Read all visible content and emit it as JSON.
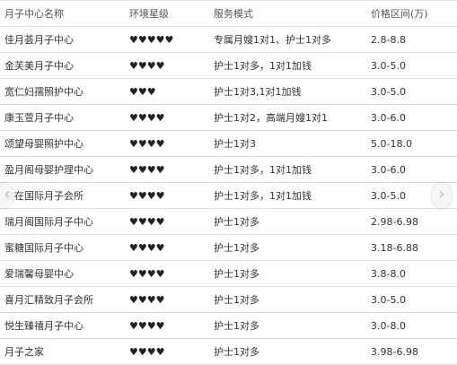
{
  "table": {
    "headers": [
      "月子中心名称",
      "环境星级",
      "服务模式",
      "价格区间(万)"
    ],
    "rows": [
      {
        "name": "佳月荟月子中心",
        "stars": "♥♥♥♥♥",
        "mode": "专属月嫂1对1、护士1对多",
        "price": "2.8-8.8"
      },
      {
        "name": "金芙美月子中心",
        "stars": "♥♥♥♥",
        "mode": "护士1对多，1对1加钱",
        "price": "3.0-5.0"
      },
      {
        "name": "宽仁妇孺照护中心",
        "stars": "♥♥♥",
        "mode": "护士1对3,1对1加钱",
        "price": "3.0-5.0"
      },
      {
        "name": "康玉萱月子中心",
        "stars": "♥♥♥♥",
        "mode": "护士1对2，高端月嫂1对1",
        "price": "3.0-6.0"
      },
      {
        "name": "颂望母婴照护中心",
        "stars": "♥♥♥♥",
        "mode": "护士1对3",
        "price": "5.0-18.0"
      },
      {
        "name": "盈月阁母婴护理中心",
        "stars": "♥♥♥♥",
        "mode": "护士1对多，1对1加钱",
        "price": "3.0-6.0"
      },
      {
        "name": "自在国际月子会所",
        "stars": "♥♥♥♥",
        "mode": "护士1对多，1对1加钱",
        "price": "3.0-5.0"
      },
      {
        "name": "瑞月阁国际月子中心",
        "stars": "♥♥♥♥",
        "mode": "护士1对多",
        "price": "2.98-6.98"
      },
      {
        "name": "蜜糖国际月子中心",
        "stars": "♥♥♥♥",
        "mode": "护士1对多",
        "price": "3.18-6.88"
      },
      {
        "name": "爱瑞馨母婴中心",
        "stars": "♥♥♥♥",
        "mode": "护士1对多",
        "price": "3.8-8.0"
      },
      {
        "name": "喜月汇精致月子会所",
        "stars": "♥♥♥♥",
        "mode": "护士1对多",
        "price": "3.0-5.0"
      },
      {
        "name": "悦生臻禧月子中心",
        "stars": "♥♥♥♥",
        "mode": "护士1对多",
        "price": "3.0-8.0"
      },
      {
        "name": "月子之家",
        "stars": "♥♥♥♥",
        "mode": "护士1对多",
        "price": "3.98-6.98"
      }
    ]
  },
  "nav": {
    "prev": "‹",
    "next": "›"
  }
}
